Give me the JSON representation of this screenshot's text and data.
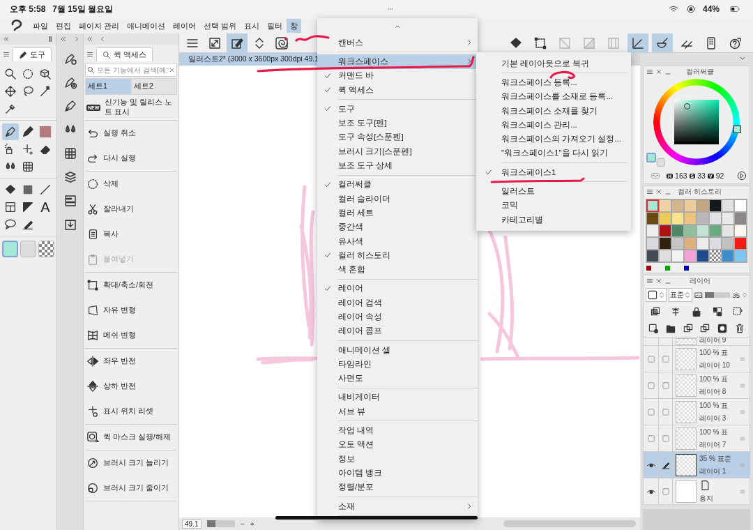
{
  "status_bar": {
    "time": "오후 5:58",
    "date": "7월 15일 월요일",
    "battery": "44%"
  },
  "menu_bar": [
    {
      "label": "파일",
      "selected": false
    },
    {
      "label": "편집",
      "selected": false
    },
    {
      "label": "페이지 관리",
      "selected": false
    },
    {
      "label": "애니메이션",
      "selected": false
    },
    {
      "label": "레이어",
      "selected": false
    },
    {
      "label": "선택 범위",
      "selected": false
    },
    {
      "label": "표시",
      "selected": false
    },
    {
      "label": "필터",
      "selected": false
    },
    {
      "label": "창",
      "selected": true
    }
  ],
  "tool_panel": {
    "tab": "도구",
    "tool_groups": [
      [
        {
          "selected": false
        },
        {
          "selected": false
        },
        {
          "selected": false
        },
        {
          "selected": false
        },
        {
          "selected": false
        },
        {
          "selected": false
        },
        {
          "selected": false
        }
      ],
      [
        {
          "selected": true
        },
        {
          "selected": false
        },
        {
          "selected": false
        },
        {
          "selected": false
        },
        {
          "selected": false
        },
        {
          "selected": false
        },
        {
          "selected": false
        },
        {
          "selected": false
        }
      ],
      [
        {
          "selected": false
        },
        {
          "selected": false
        },
        {
          "selected": false
        },
        {
          "selected": false
        },
        {
          "selected": false
        },
        {
          "selected": false,
          "glyph": "A"
        },
        {
          "selected": false
        },
        {
          "selected": false
        }
      ]
    ],
    "main_swatch": {
      "color": "#a6e8d6"
    },
    "sub_swatch": {
      "color": "#dddddd"
    }
  },
  "quick_access": {
    "tab": "퀵 액세스",
    "search_placeholder": "모든 기능에서 검색(예:",
    "sets": [
      {
        "label": "세트1",
        "selected": true
      },
      {
        "label": "세트2",
        "selected": false
      }
    ],
    "groups": [
      [
        {
          "label": "신기능 및 릴리스 노트 표시",
          "badge": "NEW",
          "disabled": false
        }
      ],
      [
        {
          "label": "실행 취소",
          "disabled": false
        },
        {
          "label": "다시 실행",
          "disabled": false
        }
      ],
      [
        {
          "label": "삭제",
          "disabled": false
        },
        {
          "label": "잘라내기",
          "disabled": false
        },
        {
          "label": "복사",
          "disabled": false
        },
        {
          "label": "붙여넣기",
          "disabled": true
        }
      ],
      [
        {
          "label": "확대/축소/회전",
          "disabled": false
        },
        {
          "label": "자유 변형",
          "disabled": false
        },
        {
          "label": "메쉬 변형",
          "disabled": false
        }
      ],
      [
        {
          "label": "좌우 반전",
          "disabled": false
        },
        {
          "label": "상하 반전",
          "disabled": false
        },
        {
          "label": "표시 위치 리셋",
          "disabled": false
        }
      ],
      [
        {
          "label": "퀵 마스크 실행/해제",
          "disabled": false
        }
      ],
      [
        {
          "label": "브러시 크기 늘리기",
          "disabled": false
        },
        {
          "label": "브러시 크기 줄이기",
          "disabled": false
        }
      ]
    ]
  },
  "command_bar": {
    "left": [
      {
        "selected": false,
        "disabled": false
      },
      {
        "selected": false,
        "disabled": false
      },
      {
        "selected": true,
        "disabled": false
      },
      {
        "selected": false,
        "disabled": false
      },
      {
        "selected": false,
        "disabled": false
      }
    ],
    "right": [
      {
        "selected": false,
        "disabled": false
      },
      {
        "selected": false,
        "disabled": false
      },
      {
        "selected": false,
        "disabled": true
      },
      {
        "selected": false,
        "disabled": true
      },
      {
        "selected": false,
        "disabled": true
      },
      {
        "selected": true,
        "disabled": false
      },
      {
        "selected": true,
        "disabled": false
      },
      {
        "selected": false,
        "disabled": false
      },
      {
        "selected": false,
        "disabled": false
      },
      {
        "selected": false,
        "disabled": false
      }
    ]
  },
  "canvas": {
    "tab": "일러스트2* (3000 x 3600px 300dpi 49.1",
    "zoom": {
      "value": "49.1",
      "level": 0.3
    },
    "zoom_out": "−",
    "zoom_in": "+"
  },
  "window_menu": {
    "groups": [
      [
        {
          "label": "캔버스",
          "kind": "submenu",
          "checked": false,
          "selected": false
        }
      ],
      [
        {
          "label": "워크스페이스",
          "kind": "submenu",
          "checked": false,
          "selected": true
        },
        {
          "label": "커맨드 바",
          "kind": "toggle",
          "checked": true,
          "selected": false
        },
        {
          "label": "퀵 액세스",
          "kind": "toggle",
          "checked": true,
          "selected": false
        }
      ],
      [
        {
          "label": "도구",
          "kind": "toggle",
          "checked": true,
          "selected": false
        },
        {
          "label": "보조 도구[펜]",
          "kind": "toggle",
          "checked": false,
          "selected": false
        },
        {
          "label": "도구 속성[스푼펜]",
          "kind": "toggle",
          "checked": false,
          "selected": false
        },
        {
          "label": "브러시 크기[스푼펜]",
          "kind": "toggle",
          "checked": false,
          "selected": false
        },
        {
          "label": "보조 도구 상세",
          "kind": "toggle",
          "checked": false,
          "selected": false
        }
      ],
      [
        {
          "label": "컬러써클",
          "kind": "toggle",
          "checked": true,
          "selected": false
        },
        {
          "label": "컬러 슬라이더",
          "kind": "toggle",
          "checked": false,
          "selected": false
        },
        {
          "label": "컬러 세트",
          "kind": "toggle",
          "checked": false,
          "selected": false
        },
        {
          "label": "중간색",
          "kind": "toggle",
          "checked": false,
          "selected": false
        },
        {
          "label": "유사색",
          "kind": "toggle",
          "checked": false,
          "selected": false
        },
        {
          "label": "컬러 히스토리",
          "kind": "toggle",
          "checked": true,
          "selected": false
        },
        {
          "label": "색 혼합",
          "kind": "toggle",
          "checked": false,
          "selected": false
        }
      ],
      [
        {
          "label": "레이어",
          "kind": "toggle",
          "checked": true,
          "selected": false
        },
        {
          "label": "레이어 검색",
          "kind": "toggle",
          "checked": false,
          "selected": false
        },
        {
          "label": "레이어 속성",
          "kind": "toggle",
          "checked": false,
          "selected": false
        },
        {
          "label": "레이어 콤프",
          "kind": "toggle",
          "checked": false,
          "selected": false
        }
      ],
      [
        {
          "label": "애니메이션 셀",
          "kind": "toggle",
          "checked": false,
          "selected": false
        },
        {
          "label": "타임라인",
          "kind": "toggle",
          "checked": false,
          "selected": false
        },
        {
          "label": "사면도",
          "kind": "toggle",
          "checked": false,
          "selected": false
        }
      ],
      [
        {
          "label": "내비게이터",
          "kind": "toggle",
          "checked": false,
          "selected": false
        },
        {
          "label": "서브 뷰",
          "kind": "toggle",
          "checked": false,
          "selected": false
        }
      ],
      [
        {
          "label": "작업 내역",
          "kind": "toggle",
          "checked": false,
          "selected": false
        },
        {
          "label": "오토 액션",
          "kind": "toggle",
          "checked": false,
          "selected": false
        },
        {
          "label": "정보",
          "kind": "toggle",
          "checked": false,
          "selected": false
        },
        {
          "label": "아이템 뱅크",
          "kind": "toggle",
          "checked": false,
          "selected": false
        },
        {
          "label": "정렬/분포",
          "kind": "toggle",
          "checked": false,
          "selected": false
        }
      ],
      [
        {
          "label": "소재",
          "kind": "submenu",
          "checked": false,
          "selected": false
        }
      ]
    ]
  },
  "workspace_submenu": {
    "groups": [
      [
        {
          "label": "기본 레이아웃으로 복귀",
          "checked": false
        }
      ],
      [
        {
          "label": "워크스페이스 등록...",
          "checked": false
        },
        {
          "label": "워크스페이스를 소재로 등록...",
          "checked": false
        },
        {
          "label": "워크스페이스 소재를 찾기",
          "checked": false
        },
        {
          "label": "워크스페이스 관리...",
          "checked": false
        },
        {
          "label": "워크스페이스의 가져오기 설정...",
          "checked": false
        },
        {
          "label": "\"워크스페이스1\"을 다시 읽기",
          "checked": false
        }
      ],
      [
        {
          "label": "워크스페이스1",
          "checked": true
        }
      ],
      [
        {
          "label": "일러스트",
          "checked": false
        },
        {
          "label": "코믹",
          "checked": false
        },
        {
          "label": "카테고리별",
          "checked": false
        }
      ]
    ]
  },
  "color_circle": {
    "title": "컬러써클",
    "main_swatch": {
      "color": "#a6e8d6"
    },
    "sub_swatch": {
      "color": "#dddddd"
    },
    "hsv": [
      {
        "label": "H",
        "value": "163"
      },
      {
        "label": "S",
        "value": "33"
      },
      {
        "label": "V",
        "value": "92"
      }
    ]
  },
  "color_history": {
    "title": "컬러 히스토리",
    "swatches": [
      {
        "color": "#a6e8d6",
        "selected": true
      },
      {
        "color": "#efd3a6",
        "selected": false
      },
      {
        "color": "#d5b58d",
        "selected": false
      },
      {
        "color": "#edcc9a",
        "selected": false
      },
      {
        "color": "#c4a57e",
        "selected": false
      },
      {
        "color": "#17181b",
        "selected": false
      },
      {
        "color": "#e2e0e2",
        "selected": false
      },
      {
        "color": "#ffffff",
        "selected": false
      },
      {
        "color": "#6d4a14",
        "selected": false
      },
      {
        "color": "#eecb58",
        "selected": false
      },
      {
        "color": "#fbe38e",
        "selected": false
      },
      {
        "color": "#efc27e",
        "selected": false
      },
      {
        "color": "#b9b7b7",
        "selected": false
      },
      {
        "color": "#e2e1e3",
        "selected": false
      },
      {
        "color": "#eaeaea",
        "selected": false
      },
      {
        "color": "#8c8888",
        "selected": false
      },
      {
        "color": "#eeeeee",
        "selected": false
      },
      {
        "color": "#ad1313",
        "selected": false
      },
      {
        "color": "#4f8665",
        "selected": false
      },
      {
        "color": "#8fc09a",
        "selected": false
      },
      {
        "color": "#c2e3d3",
        "selected": false
      },
      {
        "color": "#6aaa80",
        "selected": false
      },
      {
        "color": "#e5e5e5",
        "selected": false
      },
      {
        "color": "#fdf8f0",
        "selected": false
      },
      {
        "color": "#d9d8de",
        "selected": false
      },
      {
        "color": "#30220f",
        "selected": false
      },
      {
        "color": "#c5c5c5",
        "selected": false
      },
      {
        "color": "#ddb07c",
        "selected": false
      },
      {
        "color": "#ececee",
        "selected": false
      },
      {
        "color": "#dcdce2",
        "selected": false
      },
      {
        "color": "#c1c1c1",
        "selected": false
      },
      {
        "color": "#f31b12",
        "selected": false
      },
      {
        "color": "#424b56",
        "selected": false
      },
      {
        "color": "#dedede",
        "selected": false
      },
      {
        "color": "#f3f3f3",
        "selected": false
      },
      {
        "color": "#f5a2d7",
        "selected": false
      },
      {
        "color": "#1e4b8b",
        "selected": false
      },
      {
        "kind": "transparent",
        "selected": false
      },
      {
        "color": "#3b8dcc",
        "selected": false
      },
      {
        "color": "#7cc6f2",
        "selected": false
      }
    ],
    "channel_marks": [
      {
        "color": "#b00000"
      },
      {
        "color": "#10a010"
      },
      {
        "color": "#0000c0"
      }
    ]
  },
  "layer_panel": {
    "title": "레이어",
    "blend": "표준",
    "opacity": {
      "value": "35",
      "level": 0.35
    },
    "layers": [
      {
        "kind": "partial",
        "name": "레이어 9"
      },
      {
        "kind": "layer",
        "opacity": "100 %",
        "blend": "표",
        "name": "레이어 10",
        "visible": false,
        "editing": false,
        "selected": false
      },
      {
        "kind": "layer",
        "opacity": "100 %",
        "blend": "표",
        "name": "레이어 8",
        "visible": false,
        "editing": false,
        "selected": false
      },
      {
        "kind": "layer",
        "opacity": "100 %",
        "blend": "표",
        "name": "레이어 3",
        "visible": false,
        "editing": false,
        "selected": false
      },
      {
        "kind": "layer",
        "opacity": "100 %",
        "blend": "표",
        "name": "레이어 7",
        "visible": false,
        "editing": false,
        "selected": false
      },
      {
        "kind": "layer",
        "opacity": "35 %",
        "blend": "표준",
        "name": "레이어 1",
        "visible": true,
        "editing": true,
        "selected": true
      },
      {
        "kind": "paper",
        "name": "용지",
        "visible": true,
        "editing": false,
        "selected": false
      }
    ]
  }
}
